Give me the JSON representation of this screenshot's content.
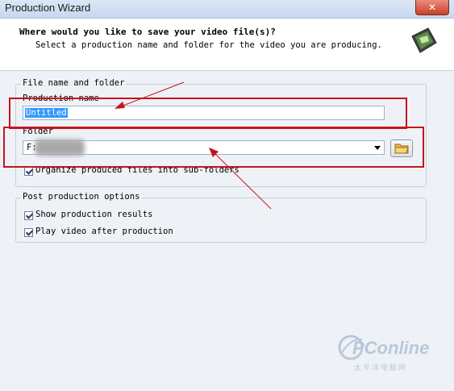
{
  "window": {
    "title": "Production Wizard",
    "close_glyph": "✕"
  },
  "header": {
    "heading": "Where would you like to save your video file(s)?",
    "subheading": "Select a production name and folder for the video you are producing.",
    "icon": "film-strip-icon"
  },
  "file_group": {
    "legend": "File name and folder",
    "production_name_label": "Production name",
    "production_name_value": "Untitled",
    "folder_label": "Folder",
    "folder_value": "F:",
    "organize_label": "Organize produced files into sub-folders",
    "organize_checked": true
  },
  "post_group": {
    "legend": "Post production options",
    "show_results_label": "Show production results",
    "show_results_checked": true,
    "play_video_label": "Play video after production",
    "play_video_checked": true
  },
  "watermark": {
    "brand": "PConline",
    "sub": "太平洋电脑网"
  },
  "colors": {
    "annotation": "#c8131b",
    "selection": "#3399ff"
  }
}
